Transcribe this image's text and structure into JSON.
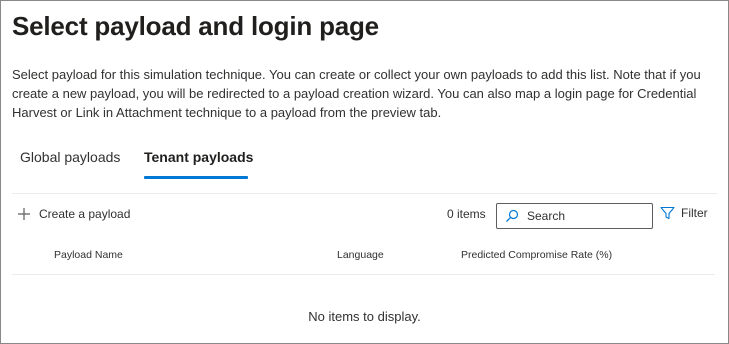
{
  "page": {
    "title": "Select payload and login page",
    "description": "Select payload for this simulation technique. You can create or collect your own payloads to add this list. Note that if you create a new payload, you will be redirected to a payload creation wizard. You can also map a login page for Credential Harvest or Link in Attachment technique to a payload from the preview tab."
  },
  "tabs": [
    {
      "label": "Global payloads",
      "selected": false
    },
    {
      "label": "Tenant payloads",
      "selected": true
    }
  ],
  "toolbar": {
    "create_label": "Create a payload",
    "create_icon": "plus-icon",
    "items_count": "0 items",
    "search_placeholder": "Search",
    "search_icon": "search-icon",
    "filter_label": "Filter",
    "filter_icon": "filter-icon"
  },
  "table": {
    "columns": [
      "Payload Name",
      "Language",
      "Predicted Compromise Rate (%)"
    ],
    "rows": [],
    "empty_message": "No items to display."
  },
  "colors": {
    "accent": "#0078d4",
    "border": "#8a8886",
    "divider": "#edebe9",
    "text": "#323130"
  }
}
